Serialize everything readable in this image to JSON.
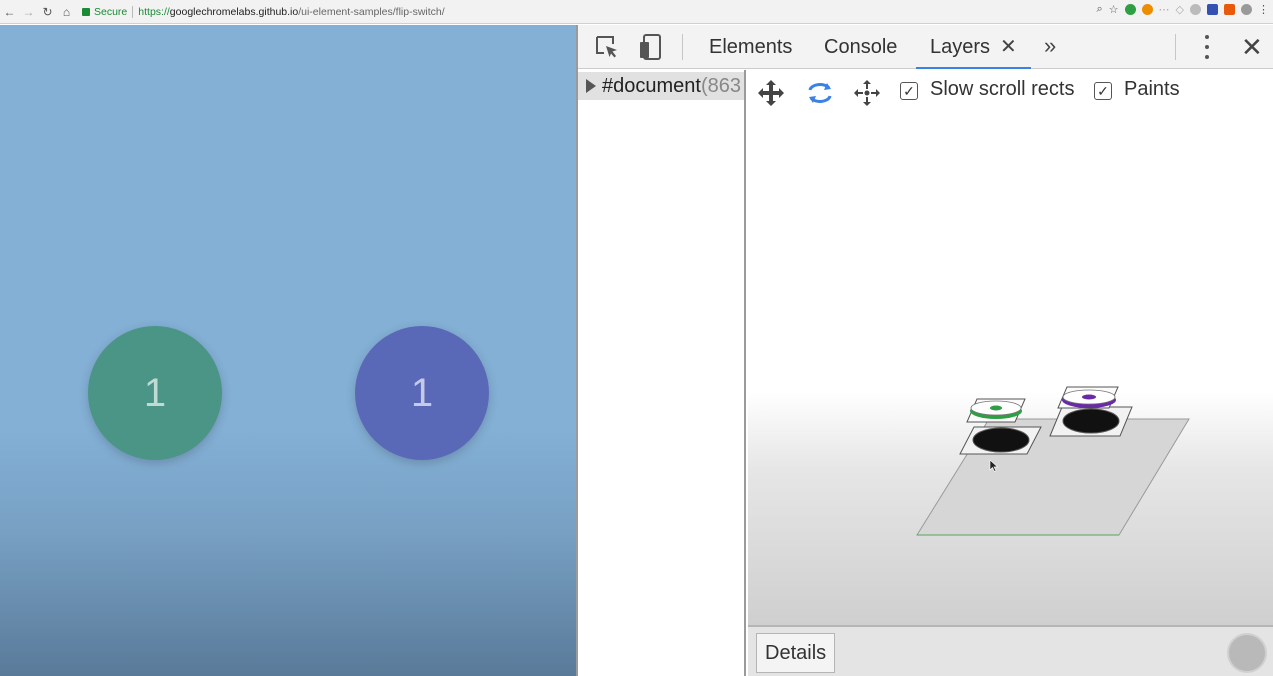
{
  "browser": {
    "security_label": "Secure",
    "url_scheme": "https://",
    "url_host": "googlechromelabs.github.io",
    "url_path": "/ui-element-samples/flip-switch/"
  },
  "page": {
    "circles": [
      {
        "label": "1",
        "color": "#4a9585"
      },
      {
        "label": "1",
        "color": "#5a68b8"
      }
    ]
  },
  "devtools": {
    "tabs": [
      {
        "label": "Elements",
        "active": false
      },
      {
        "label": "Console",
        "active": false
      },
      {
        "label": "Layers",
        "active": true,
        "closable": true
      }
    ],
    "more_tabs_glyph": "»",
    "close_glyph": "✕",
    "tab_close_glyph": "✕",
    "tree": {
      "root_label": "#document",
      "root_suffix": "(863"
    },
    "layers_toolbar": {
      "tools": [
        "pan-mode-icon",
        "rotate-mode-icon",
        "reset-transform-icon"
      ],
      "checkboxes": [
        {
          "label": "Slow scroll rects",
          "checked": true
        },
        {
          "label": "Paints",
          "checked": true
        }
      ]
    },
    "details_tab_label": "Details",
    "accent_color": "#3b82e6"
  }
}
